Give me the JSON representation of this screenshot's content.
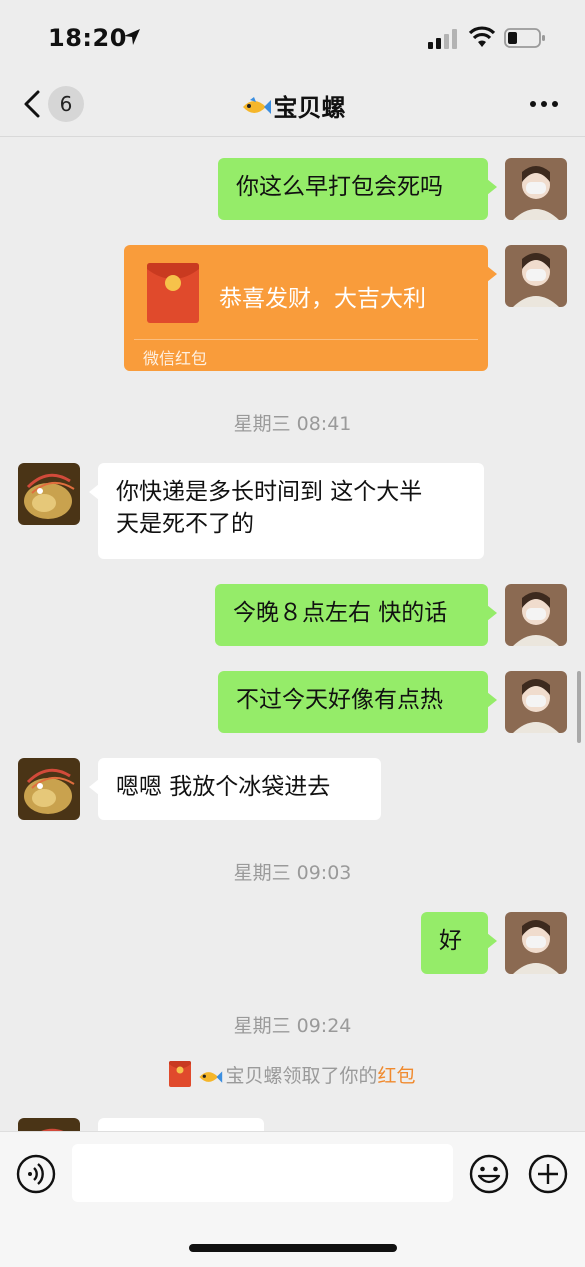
{
  "status_bar": {
    "time": "18:20"
  },
  "nav": {
    "unread_count": "6",
    "title": "宝贝螺"
  },
  "messages": [
    {
      "side": "me",
      "text": "你这么早打包会死吗"
    },
    {
      "side": "me",
      "type": "red_packet",
      "text": "恭喜发财，大吉大利",
      "label": "微信红包"
    },
    {
      "type": "timestamp",
      "text": "星期三 08:41"
    },
    {
      "side": "them",
      "text_line1": "你快递是多长时间到  这个大半",
      "text_line2": "天是死不了的"
    },
    {
      "side": "me",
      "text": "今晚８点左右 快的话"
    },
    {
      "side": "me",
      "text": "不过今天好像有点热"
    },
    {
      "side": "them",
      "text": "嗯嗯 我放个冰袋进去"
    },
    {
      "type": "timestamp",
      "text": "星期三 09:03"
    },
    {
      "side": "me",
      "text": "好"
    },
    {
      "type": "timestamp",
      "text": "星期三 09:24"
    },
    {
      "type": "system",
      "name": "宝贝螺",
      "action": "领取了你的",
      "highlight": "红包"
    }
  ],
  "colors": {
    "my_bubble": "#95ec69",
    "their_bubble": "#ffffff",
    "red_packet": "#f99c3b",
    "highlight": "#f08a2e",
    "background": "#ededed"
  },
  "icons": [
    "location-arrow-icon",
    "signal-icon",
    "wifi-icon",
    "battery-icon",
    "back-chevron-icon",
    "more-icon",
    "voice-icon",
    "emoji-icon",
    "plus-icon",
    "red-packet-icon",
    "fish-icon"
  ]
}
